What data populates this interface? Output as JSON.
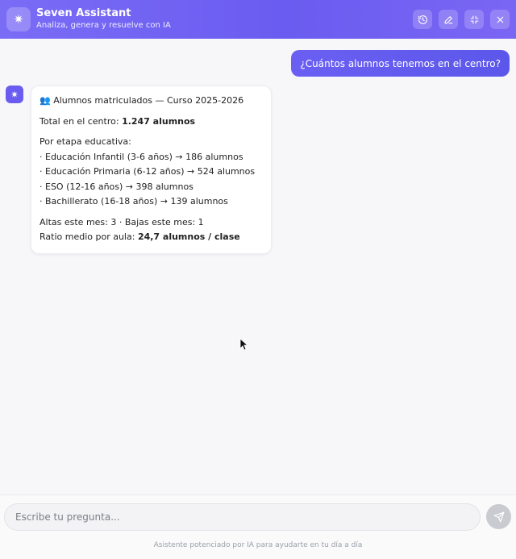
{
  "header": {
    "logo_glyph": "✷",
    "title": "Seven Assistant",
    "subtitle": "Analiza, genera y resuelve con IA",
    "actions": [
      "history-icon",
      "edit-icon",
      "minimize-icon",
      "close-icon"
    ]
  },
  "colors": {
    "accent": "#6a5cf0",
    "header_gradient_start": "#7b6cf6",
    "user_bubble": "#5b57ea",
    "send_button_disabled": "#c9cbd1"
  },
  "chat": {
    "user_message": "¿Cuántos alumnos tenemos en el centro?",
    "bot_avatar_glyph": "✷",
    "bot": {
      "heading": "👥 Alumnos matriculados — Curso 2025-2026",
      "total_prefix": "Total en el centro: ",
      "total_value": "1.247 alumnos",
      "stages_title": "Por etapa educativa:",
      "stages": [
        "· Educación Infantil (3-6 años) → 186 alumnos",
        "· Educación Primaria (6-12 años) → 524 alumnos",
        "· ESO (12-16 años) → 398 alumnos",
        "· Bachillerato (16-18 años) → 139 alumnos"
      ],
      "movements": "Altas este mes: 3 · Bajas este mes: 1",
      "ratio_prefix": "Ratio medio por aula: ",
      "ratio_value": "24,7 alumnos / clase"
    }
  },
  "composer": {
    "placeholder": "Escribe tu pregunta...",
    "value": "",
    "disclaimer": "Asistente potenciado por IA para ayudarte en tu día a día"
  }
}
